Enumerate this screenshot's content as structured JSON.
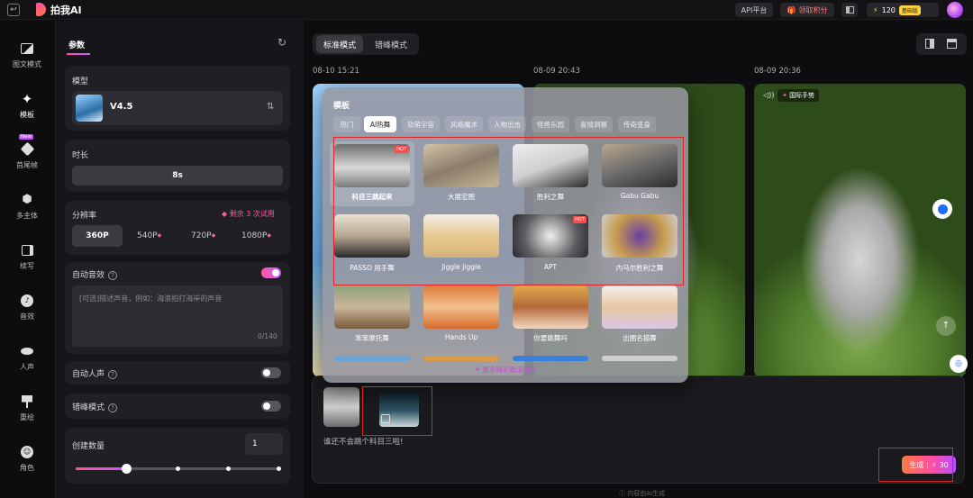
{
  "topbar": {
    "back_icon": "back-icon",
    "brand": "拍我AI",
    "api_label": "API平台",
    "points_label": "领取积分",
    "credits": "120",
    "plan": "基础版"
  },
  "nav": [
    {
      "label": "图文模式",
      "icon": "image-icon"
    },
    {
      "label": "模板",
      "icon": "sparkle-icon"
    },
    {
      "label": "首尾帧",
      "icon": "frames-icon",
      "badge": "New"
    },
    {
      "label": "多主体",
      "icon": "cube-icon"
    },
    {
      "label": "续写",
      "icon": "continue-icon"
    },
    {
      "label": "音效",
      "icon": "sound-icon"
    },
    {
      "label": "人声",
      "icon": "lips-icon"
    },
    {
      "label": "重绘",
      "icon": "brush-icon"
    },
    {
      "label": "角色",
      "icon": "face-icon"
    }
  ],
  "params": {
    "tab": "参数",
    "model_label": "模型",
    "model_value": "V4.5",
    "duration_label": "时长",
    "duration_value": "8s",
    "resolution_label": "分辨率",
    "resolution_trial": "剩余 3 次试用",
    "resolutions": [
      "360P",
      "540P",
      "720P",
      "1080P"
    ],
    "auto_sfx_label": "自动音效",
    "sfx_placeholder": "[可选]描述声音，例如：海浪拍打海岸的声音",
    "sfx_counter": "0/140",
    "auto_voice_label": "自动人声",
    "peak_label": "错峰模式",
    "count_label": "创建数量",
    "count_value": "1"
  },
  "main": {
    "mode_standard": "标准模式",
    "mode_offpeak": "错峰模式",
    "timestamps": [
      "08-10 15:21",
      "08-09 20:43",
      "08-09 20:36"
    ],
    "card3_tag": "国际手势",
    "prompt_text": "谁还不会跳个科目三啦!",
    "generate_label": "生成",
    "generate_cost": "30",
    "footer": "内容由AI生成"
  },
  "templates": {
    "title": "模板",
    "categories": [
      "热门",
      "AI热舞",
      "软萌宇宙",
      "风格魔术",
      "人物出击",
      "怪兽乐园",
      "喜情洞察",
      "传奇变身"
    ],
    "active_category": "AI热舞",
    "items": [
      {
        "label": "科目三跳起来",
        "hot": true
      },
      {
        "label": "大展宏图",
        "hot": false
      },
      {
        "label": "胜利之舞",
        "hot": false
      },
      {
        "label": "Gabu Gabu",
        "hot": false
      },
      {
        "label": "PASSO 用手舞",
        "hot": false
      },
      {
        "label": "Jiggle Jiggle",
        "hot": false
      },
      {
        "label": "APT",
        "hot": true
      },
      {
        "label": "内马尔胜利之舞",
        "hot": false
      },
      {
        "label": "笨笨摩托舞",
        "hot": false
      },
      {
        "label": "Hands Up",
        "hot": false
      },
      {
        "label": "你要跳舞吗",
        "hot": false
      },
      {
        "label": "出圈名猫舞",
        "hot": false
      }
    ],
    "footer": "更多精彩敬请期待"
  },
  "colors": {
    "accent_pink": "#ff4fa3",
    "accent_orange": "#ff7a3d",
    "highlight_red": "#e02424",
    "bg": "#0d0d10"
  }
}
